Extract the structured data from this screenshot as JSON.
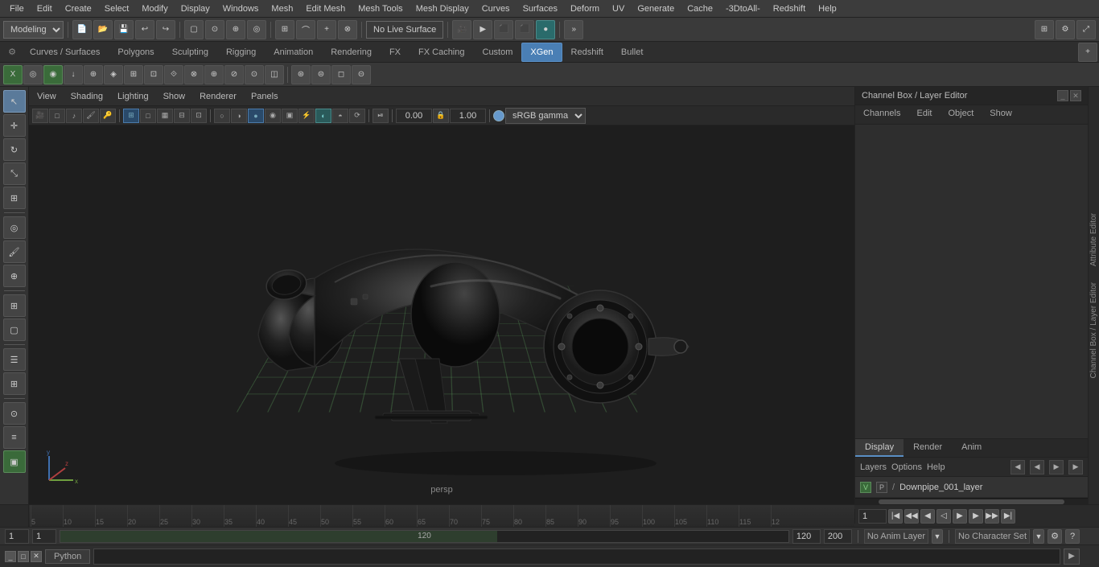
{
  "menubar": {
    "items": [
      "File",
      "Edit",
      "Create",
      "Select",
      "Modify",
      "Display",
      "Windows",
      "Mesh",
      "Edit Mesh",
      "Mesh Tools",
      "Mesh Display",
      "Curves",
      "Surfaces",
      "Deform",
      "UV",
      "Generate",
      "Cache",
      "-3DtoAll-",
      "Redshift",
      "Help"
    ]
  },
  "toolbar1": {
    "mode_label": "Modeling",
    "live_surface": "No Live Surface"
  },
  "tabs": {
    "items": [
      "Curves / Surfaces",
      "Polygons",
      "Sculpting",
      "Rigging",
      "Animation",
      "Rendering",
      "FX",
      "FX Caching",
      "Custom",
      "XGen",
      "Redshift",
      "Bullet"
    ],
    "active": "XGen"
  },
  "viewport": {
    "menus": [
      "View",
      "Shading",
      "Lighting",
      "Show",
      "Renderer",
      "Panels"
    ],
    "persp_label": "persp",
    "camera_value": "0.00",
    "focal_value": "1.00",
    "colorspace": "sRGB gamma"
  },
  "right_panel": {
    "title": "Channel Box / Layer Editor",
    "channel_tabs": [
      "Channels",
      "Edit",
      "Object",
      "Show"
    ],
    "display_tabs": [
      "Display",
      "Render",
      "Anim"
    ],
    "active_display_tab": "Display",
    "layers_options": [
      "Layers",
      "Options",
      "Help"
    ],
    "layer_row": {
      "v": "V",
      "p": "P",
      "slash": "/",
      "name": "Downpipe_001_layer"
    }
  },
  "status_bar": {
    "frame_current": "1",
    "frame_start": "1",
    "range_start": "1",
    "range_end": "120",
    "playback_end": "120",
    "total_frames": "200",
    "anim_layer": "No Anim Layer",
    "char_set": "No Character Set"
  },
  "bottom_bar": {
    "python_label": "Python",
    "input_placeholder": ""
  },
  "attr_editor": {
    "label": "Attribute Editor"
  },
  "ch_box_sidebar": {
    "label": "Channel Box / Layer Editor"
  },
  "timeline": {
    "marks": [
      "5",
      "10",
      "15",
      "20",
      "25",
      "30",
      "35",
      "40",
      "45",
      "50",
      "55",
      "60",
      "65",
      "70",
      "75",
      "80",
      "85",
      "90",
      "95",
      "100",
      "105",
      "110",
      "115",
      "12"
    ]
  },
  "icons": {
    "arrow": "↖",
    "move": "✛",
    "rotate": "↻",
    "scale": "⤡",
    "select": "▢",
    "lasso": "⊙",
    "soft": "◈",
    "snap_grid": "⊞",
    "snap_curve": "⌒",
    "snap_point": "⊕",
    "magnet": "⊗",
    "camera": "📷",
    "render": "▶",
    "refresh": "⟳",
    "left_arrow": "◀",
    "right_arrow": "▶",
    "up_arrow": "▲",
    "down_arrow": "▼"
  }
}
